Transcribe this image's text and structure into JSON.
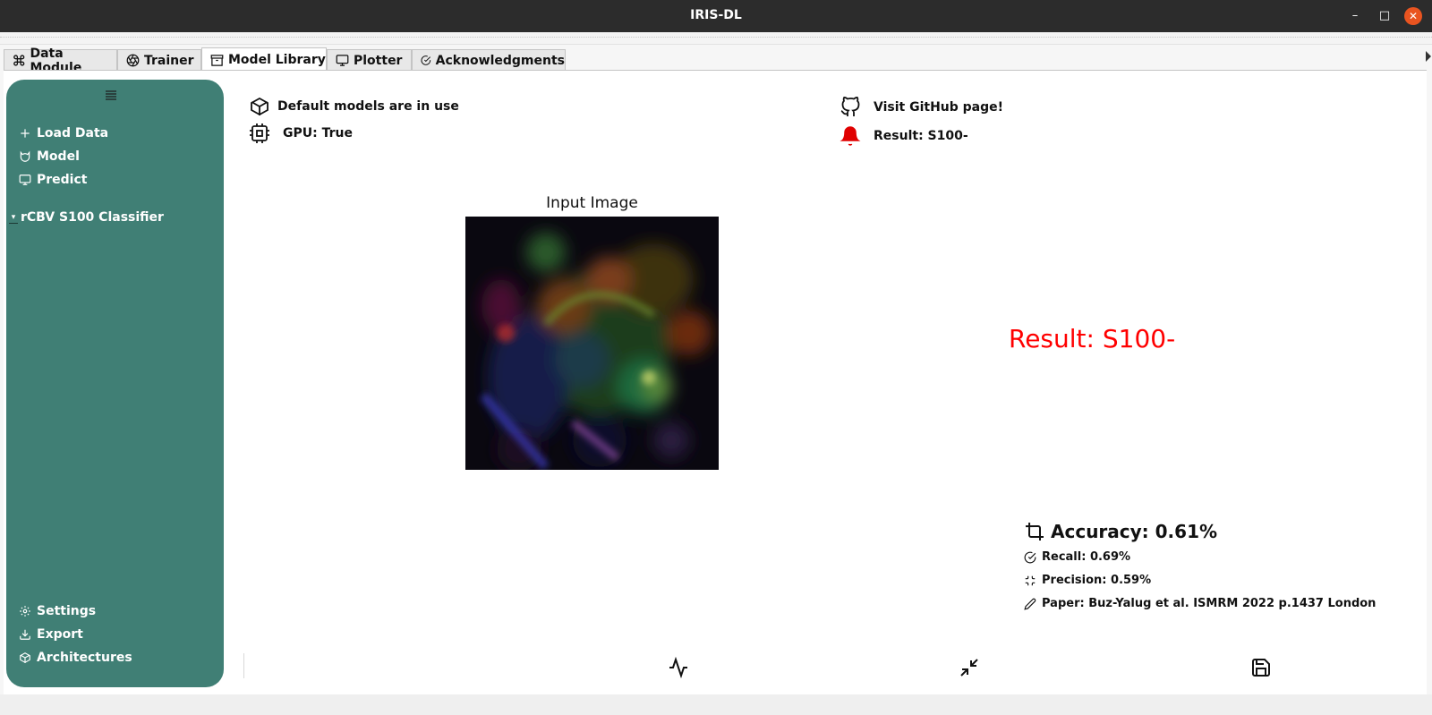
{
  "window": {
    "title": "IRIS-DL"
  },
  "tabs": [
    {
      "label": "Data Module",
      "icon": "command-icon"
    },
    {
      "label": "Trainer",
      "icon": "aperture-icon"
    },
    {
      "label": "Model Library",
      "icon": "archive-icon",
      "active": true
    },
    {
      "label": "Plotter",
      "icon": "monitor-icon"
    },
    {
      "label": "Acknowledgments",
      "icon": "check-circle-icon"
    }
  ],
  "sidebar": {
    "color": "#407f75",
    "top_items": [
      {
        "label": "Load Data",
        "icon": "plus-icon"
      },
      {
        "label": "Model",
        "icon": "cat-icon"
      },
      {
        "label": "Predict",
        "icon": "monitor-icon"
      }
    ],
    "tree": {
      "label": "rCBV S100 Classifier"
    },
    "bottom_items": [
      {
        "label": "Settings",
        "icon": "gear-icon"
      },
      {
        "label": "Export",
        "icon": "download-icon"
      },
      {
        "label": "Architectures",
        "icon": "codesandbox-icon"
      }
    ]
  },
  "status": {
    "models": "Default models are in use",
    "gpu": "GPU:  True",
    "github": "Visit GitHub page!",
    "result": "Result: S100-"
  },
  "image_panel": {
    "title": "Input Image"
  },
  "result_big": {
    "text": "Result: S100-",
    "color": "#ff0000"
  },
  "metrics": {
    "accuracy": "Accuracy: 0.61%",
    "recall": "Recall: 0.69%",
    "precision": "Precision: 0.59%",
    "paper": "Paper: Buz-Yalug et al. ISMRM 2022 p.1437 London"
  },
  "bottom_toolbar": {
    "icons": [
      "activity-icon",
      "minimize-icon",
      "save-icon"
    ]
  }
}
